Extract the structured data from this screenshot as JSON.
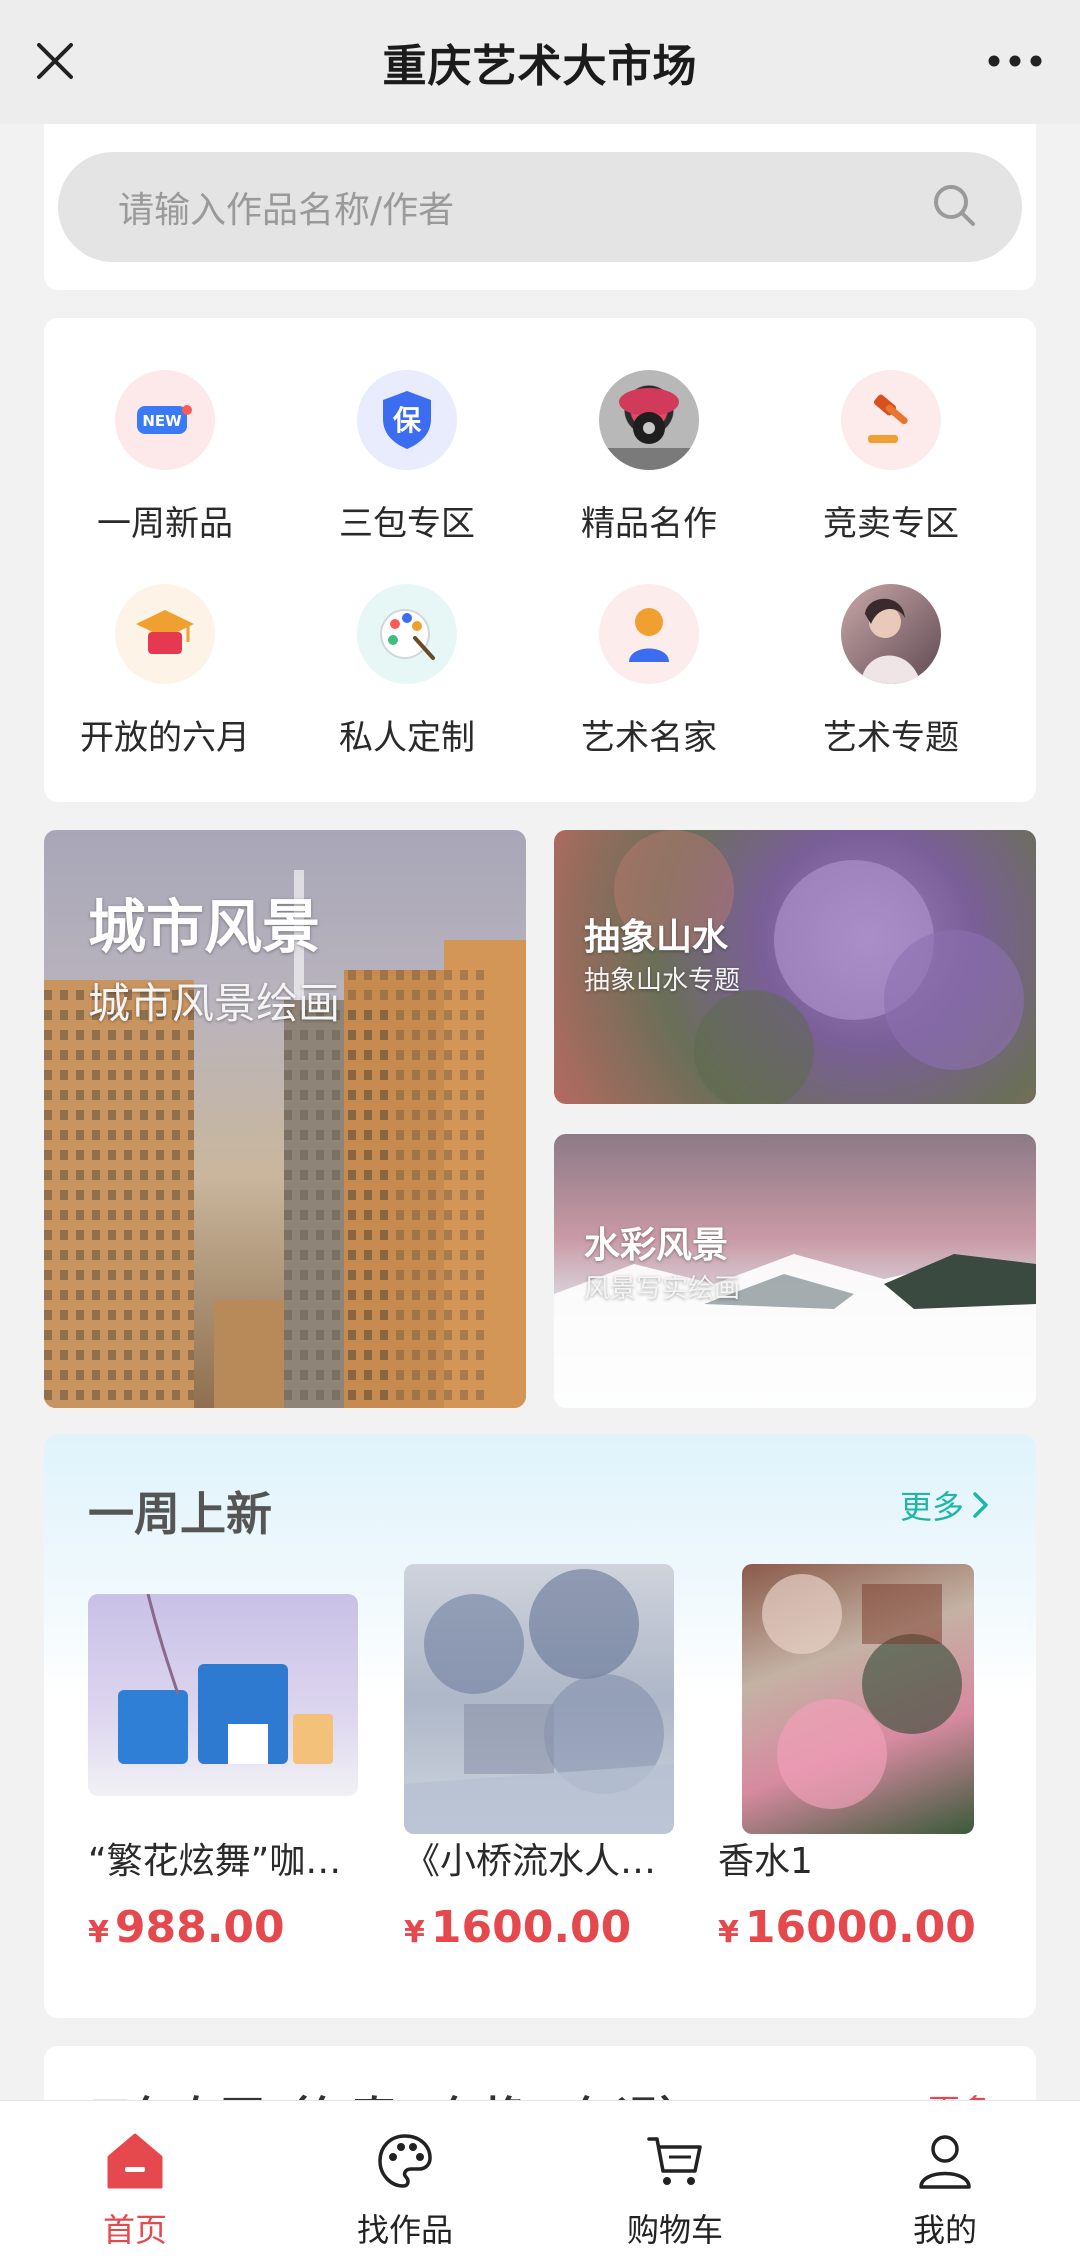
{
  "header": {
    "title": "重庆艺术大市场",
    "close_icon": "close-icon",
    "more_icon": "more-dots-icon"
  },
  "search": {
    "placeholder": "请输入作品名称/作者",
    "icon": "search-icon"
  },
  "categories": [
    {
      "label": "一周新品",
      "icon": "new-badge-icon",
      "color": "#fde8ea"
    },
    {
      "label": "三包专区",
      "icon": "shield-icon",
      "color": "#e8ecfd"
    },
    {
      "label": "精品名作",
      "icon": "artwork-thumbnail",
      "color": "#c8c8c8"
    },
    {
      "label": "竞卖专区",
      "icon": "auction-gavel-icon",
      "color": "#fdeaea"
    },
    {
      "label": "开放的六月",
      "icon": "graduation-cap-icon",
      "color": "#fdf3e6"
    },
    {
      "label": "私人定制",
      "icon": "palette-icon",
      "color": "#e6f7f6"
    },
    {
      "label": "艺术名家",
      "icon": "artist-person-icon",
      "color": "#fdecec"
    },
    {
      "label": "艺术专题",
      "icon": "portrait-thumbnail",
      "color": "#d9c7c9"
    }
  ],
  "banners": {
    "city": {
      "title": "城市风景",
      "subtitle": "城市风景绘画"
    },
    "abstract": {
      "title": "抽象山水",
      "subtitle": "抽象山水专题"
    },
    "watercolor": {
      "title": "水彩风景",
      "subtitle": "风景写实绘画"
    }
  },
  "weekly": {
    "title": "一周上新",
    "more": "更多",
    "products": [
      {
        "name": "“繁花炫舞”咖…",
        "currency": "¥",
        "price": "988.00"
      },
      {
        "name": "《小桥流水人…",
        "currency": "¥",
        "price": "1600.00"
      },
      {
        "name": "香水1",
        "currency": "¥",
        "price": "16000.00"
      }
    ]
  },
  "next_section": {
    "title": "三包专区（包真、包换、包退）",
    "more": "更多"
  },
  "tabbar": {
    "items": [
      {
        "label": "首页",
        "icon": "home-icon",
        "active": true
      },
      {
        "label": "找作品",
        "icon": "palette-icon",
        "active": false
      },
      {
        "label": "购物车",
        "icon": "cart-icon",
        "active": false
      },
      {
        "label": "我的",
        "icon": "user-icon",
        "active": false
      }
    ]
  },
  "colors": {
    "accent": "#e5484d",
    "teal": "#1fb6a6",
    "background": "#f2f2f2"
  }
}
